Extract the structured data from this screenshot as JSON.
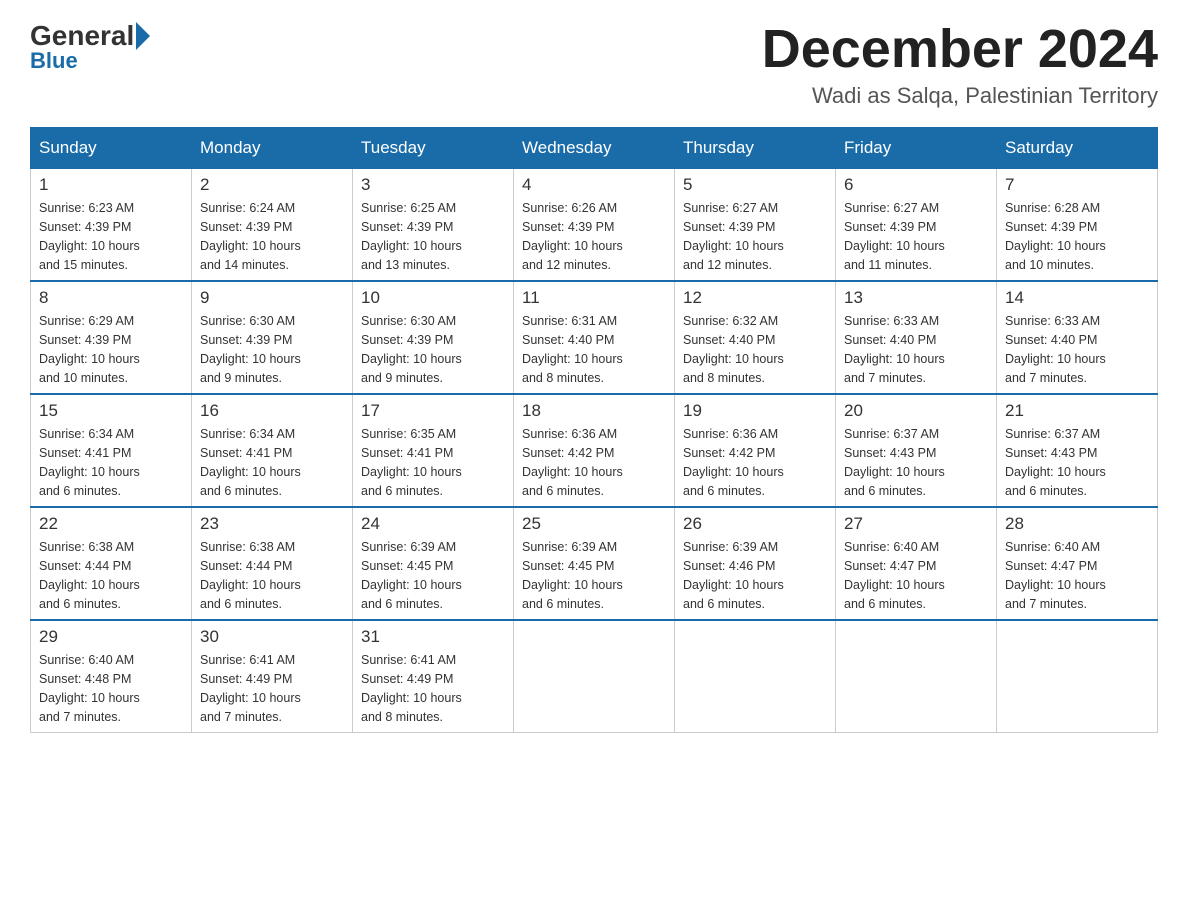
{
  "header": {
    "logo": {
      "general": "General",
      "blue": "Blue"
    },
    "title": "December 2024",
    "location": "Wadi as Salqa, Palestinian Territory"
  },
  "calendar": {
    "days_of_week": [
      "Sunday",
      "Monday",
      "Tuesday",
      "Wednesday",
      "Thursday",
      "Friday",
      "Saturday"
    ],
    "weeks": [
      [
        {
          "day": "1",
          "sunrise": "6:23 AM",
          "sunset": "4:39 PM",
          "daylight": "10 hours and 15 minutes."
        },
        {
          "day": "2",
          "sunrise": "6:24 AM",
          "sunset": "4:39 PM",
          "daylight": "10 hours and 14 minutes."
        },
        {
          "day": "3",
          "sunrise": "6:25 AM",
          "sunset": "4:39 PM",
          "daylight": "10 hours and 13 minutes."
        },
        {
          "day": "4",
          "sunrise": "6:26 AM",
          "sunset": "4:39 PM",
          "daylight": "10 hours and 12 minutes."
        },
        {
          "day": "5",
          "sunrise": "6:27 AM",
          "sunset": "4:39 PM",
          "daylight": "10 hours and 12 minutes."
        },
        {
          "day": "6",
          "sunrise": "6:27 AM",
          "sunset": "4:39 PM",
          "daylight": "10 hours and 11 minutes."
        },
        {
          "day": "7",
          "sunrise": "6:28 AM",
          "sunset": "4:39 PM",
          "daylight": "10 hours and 10 minutes."
        }
      ],
      [
        {
          "day": "8",
          "sunrise": "6:29 AM",
          "sunset": "4:39 PM",
          "daylight": "10 hours and 10 minutes."
        },
        {
          "day": "9",
          "sunrise": "6:30 AM",
          "sunset": "4:39 PM",
          "daylight": "10 hours and 9 minutes."
        },
        {
          "day": "10",
          "sunrise": "6:30 AM",
          "sunset": "4:39 PM",
          "daylight": "10 hours and 9 minutes."
        },
        {
          "day": "11",
          "sunrise": "6:31 AM",
          "sunset": "4:40 PM",
          "daylight": "10 hours and 8 minutes."
        },
        {
          "day": "12",
          "sunrise": "6:32 AM",
          "sunset": "4:40 PM",
          "daylight": "10 hours and 8 minutes."
        },
        {
          "day": "13",
          "sunrise": "6:33 AM",
          "sunset": "4:40 PM",
          "daylight": "10 hours and 7 minutes."
        },
        {
          "day": "14",
          "sunrise": "6:33 AM",
          "sunset": "4:40 PM",
          "daylight": "10 hours and 7 minutes."
        }
      ],
      [
        {
          "day": "15",
          "sunrise": "6:34 AM",
          "sunset": "4:41 PM",
          "daylight": "10 hours and 6 minutes."
        },
        {
          "day": "16",
          "sunrise": "6:34 AM",
          "sunset": "4:41 PM",
          "daylight": "10 hours and 6 minutes."
        },
        {
          "day": "17",
          "sunrise": "6:35 AM",
          "sunset": "4:41 PM",
          "daylight": "10 hours and 6 minutes."
        },
        {
          "day": "18",
          "sunrise": "6:36 AM",
          "sunset": "4:42 PM",
          "daylight": "10 hours and 6 minutes."
        },
        {
          "day": "19",
          "sunrise": "6:36 AM",
          "sunset": "4:42 PM",
          "daylight": "10 hours and 6 minutes."
        },
        {
          "day": "20",
          "sunrise": "6:37 AM",
          "sunset": "4:43 PM",
          "daylight": "10 hours and 6 minutes."
        },
        {
          "day": "21",
          "sunrise": "6:37 AM",
          "sunset": "4:43 PM",
          "daylight": "10 hours and 6 minutes."
        }
      ],
      [
        {
          "day": "22",
          "sunrise": "6:38 AM",
          "sunset": "4:44 PM",
          "daylight": "10 hours and 6 minutes."
        },
        {
          "day": "23",
          "sunrise": "6:38 AM",
          "sunset": "4:44 PM",
          "daylight": "10 hours and 6 minutes."
        },
        {
          "day": "24",
          "sunrise": "6:39 AM",
          "sunset": "4:45 PM",
          "daylight": "10 hours and 6 minutes."
        },
        {
          "day": "25",
          "sunrise": "6:39 AM",
          "sunset": "4:45 PM",
          "daylight": "10 hours and 6 minutes."
        },
        {
          "day": "26",
          "sunrise": "6:39 AM",
          "sunset": "4:46 PM",
          "daylight": "10 hours and 6 minutes."
        },
        {
          "day": "27",
          "sunrise": "6:40 AM",
          "sunset": "4:47 PM",
          "daylight": "10 hours and 6 minutes."
        },
        {
          "day": "28",
          "sunrise": "6:40 AM",
          "sunset": "4:47 PM",
          "daylight": "10 hours and 7 minutes."
        }
      ],
      [
        {
          "day": "29",
          "sunrise": "6:40 AM",
          "sunset": "4:48 PM",
          "daylight": "10 hours and 7 minutes."
        },
        {
          "day": "30",
          "sunrise": "6:41 AM",
          "sunset": "4:49 PM",
          "daylight": "10 hours and 7 minutes."
        },
        {
          "day": "31",
          "sunrise": "6:41 AM",
          "sunset": "4:49 PM",
          "daylight": "10 hours and 8 minutes."
        },
        null,
        null,
        null,
        null
      ]
    ],
    "labels": {
      "sunrise": "Sunrise:",
      "sunset": "Sunset:",
      "daylight": "Daylight:"
    }
  }
}
